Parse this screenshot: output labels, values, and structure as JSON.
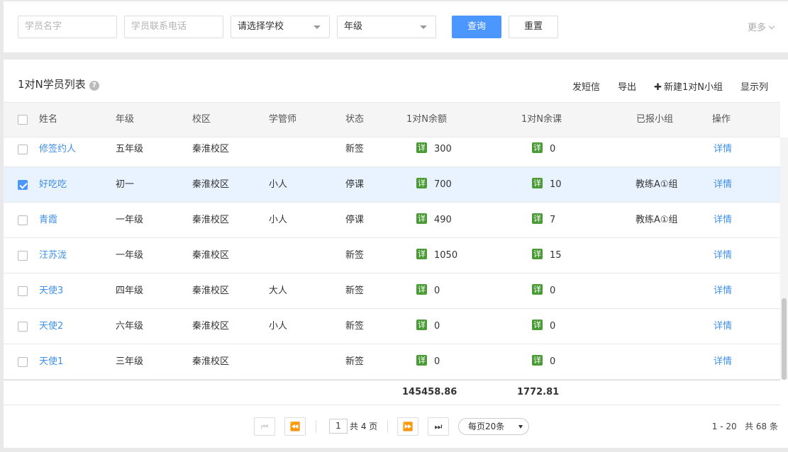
{
  "search": {
    "name_placeholder": "学员名字",
    "phone_placeholder": "学员联系电话",
    "school_select": "请选择学校",
    "grade_select": "年级",
    "query_label": "查询",
    "reset_label": "重置",
    "more_label": "更多"
  },
  "list": {
    "title": "1对N学员列表",
    "help_icon": "?",
    "toolbar": {
      "sms_label": "发短信",
      "export_label": "导出",
      "new_group_label": "新建1对N小组",
      "display_cols_label": "显示列"
    },
    "columns": [
      "姓名",
      "年级",
      "校区",
      "学管师",
      "状态",
      "1对N余额",
      "1对N余课",
      "已报小组",
      "操作"
    ],
    "detail_tag": "详",
    "rows": [
      {
        "name": "修签约人",
        "grade": "五年级",
        "campus": "秦淮校区",
        "manager": "",
        "status": "新签",
        "balance": "300",
        "lessons": "0",
        "group": "",
        "action": "详情",
        "checked": false
      },
      {
        "name": "好吃吃",
        "grade": "初一",
        "campus": "秦淮校区",
        "manager": "小人",
        "status": "停课",
        "balance": "700",
        "lessons": "10",
        "group": "教练A①组",
        "action": "详情",
        "checked": true
      },
      {
        "name": "青霞",
        "grade": "一年级",
        "campus": "秦淮校区",
        "manager": "小人",
        "status": "停课",
        "balance": "490",
        "lessons": "7",
        "group": "教练A①组",
        "action": "详情",
        "checked": false
      },
      {
        "name": "汪苏泷",
        "grade": "一年级",
        "campus": "秦淮校区",
        "manager": "",
        "status": "新签",
        "balance": "1050",
        "lessons": "15",
        "group": "",
        "action": "详情",
        "checked": false
      },
      {
        "name": "天使3",
        "grade": "四年级",
        "campus": "秦淮校区",
        "manager": "大人",
        "status": "新签",
        "balance": "0",
        "lessons": "0",
        "group": "",
        "action": "详情",
        "checked": false
      },
      {
        "name": "天使2",
        "grade": "六年级",
        "campus": "秦淮校区",
        "manager": "小人",
        "status": "新签",
        "balance": "0",
        "lessons": "0",
        "group": "",
        "action": "详情",
        "checked": false
      },
      {
        "name": "天使1",
        "grade": "三年级",
        "campus": "秦淮校区",
        "manager": "",
        "status": "新签",
        "balance": "0",
        "lessons": "0",
        "group": "",
        "action": "详情",
        "checked": false
      }
    ],
    "totals": {
      "balance": "145458.86",
      "lessons": "1772.81"
    }
  },
  "pager": {
    "first_icon": "⏮",
    "prev_icon": "⏪",
    "next_icon": "⏩",
    "last_icon": "⏭",
    "current_page": "1",
    "total_pages_text": "共 4 页",
    "page_size": "每页20条",
    "range_text": "1 - 20",
    "total_text": "共 68 条"
  },
  "colors": {
    "primary": "#4c97ff",
    "link": "#3f8fe6",
    "tag": "#4a9a35",
    "selected_row": "#e9f2ff"
  }
}
